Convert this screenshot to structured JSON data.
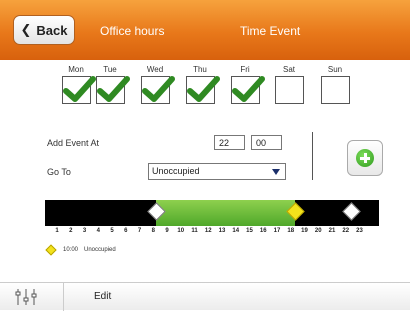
{
  "header": {
    "back_label": "Back",
    "office_label": "Office hours",
    "event_label": "Time Event",
    "accent_color": "#e8781a"
  },
  "days": [
    {
      "label": "Mon",
      "checked": true
    },
    {
      "label": "Tue",
      "checked": true
    },
    {
      "label": "Wed",
      "checked": true
    },
    {
      "label": "Thu",
      "checked": true
    },
    {
      "label": "Fri",
      "checked": true
    },
    {
      "label": "Sat",
      "checked": false
    },
    {
      "label": "Sun",
      "checked": false
    }
  ],
  "form": {
    "add_event_label": "Add Event At",
    "hour_value": "22",
    "minute_value": "00",
    "goto_label": "Go To",
    "goto_value": "Unoccupied"
  },
  "timeline": {
    "range_hours": [
      0,
      24
    ],
    "occupied_from": 8,
    "occupied_to": 18,
    "markers": [
      {
        "hour": 8,
        "color": "white"
      },
      {
        "hour": 18,
        "color": "yellow"
      },
      {
        "hour": 22,
        "color": "white"
      }
    ],
    "ticks": [
      "1",
      "2",
      "3",
      "4",
      "5",
      "6",
      "7",
      "8",
      "9",
      "10",
      "11",
      "12",
      "13",
      "14",
      "15",
      "16",
      "17",
      "18",
      "19",
      "20",
      "21",
      "22",
      "23"
    ],
    "occupied_color": "#5cb531",
    "unoccupied_color": "#000000"
  },
  "legend": {
    "time": "10:00",
    "state": "Unoccupied"
  },
  "footer": {
    "edit_label": "Edit"
  }
}
